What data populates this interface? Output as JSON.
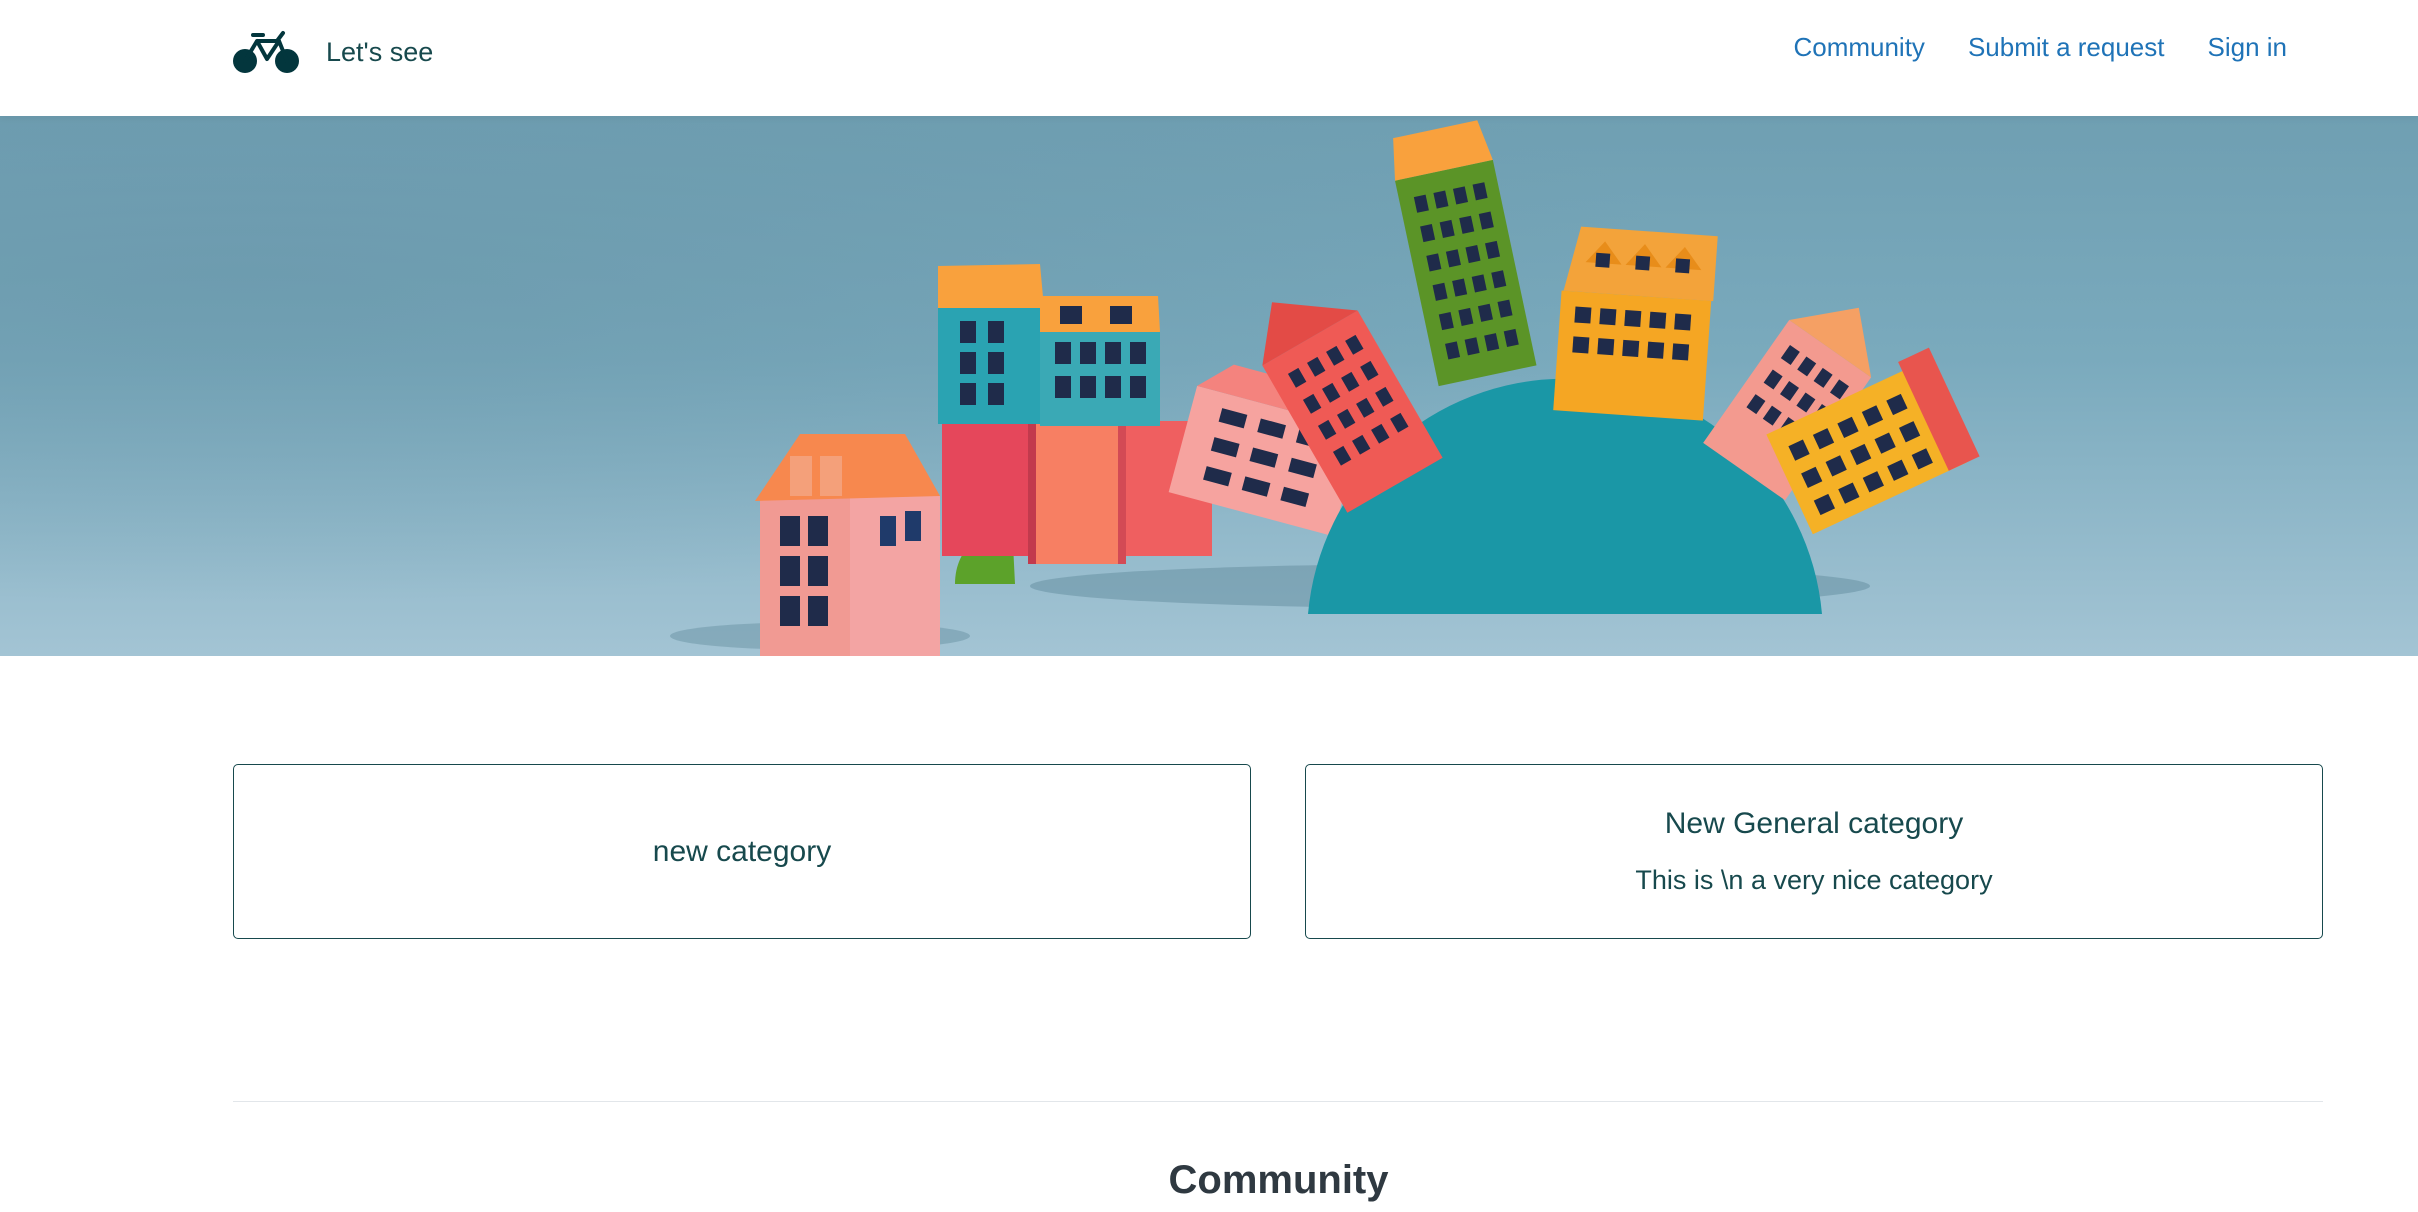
{
  "header": {
    "brand_name": "Let's see",
    "logo_icon": "bicycle-icon",
    "nav": {
      "community": "Community",
      "submit_request": "Submit a request",
      "sign_in": "Sign in"
    }
  },
  "hero": {
    "image": "paper-houses-illustration",
    "background_color": "#7fa6b8"
  },
  "blocks": [
    {
      "title": "new category",
      "description": ""
    },
    {
      "title": "New General category",
      "description": "This is \\n a very nice category"
    }
  ],
  "community": {
    "title": "Community"
  },
  "colors": {
    "brand": "#17494d",
    "link": "#1f73b7",
    "text": "#2f3941",
    "divider": "#e2e6ea"
  }
}
